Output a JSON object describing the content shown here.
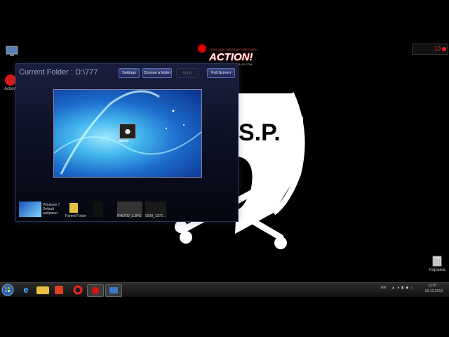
{
  "recorder": {
    "caption": "THIS VIDEO WAS CAPTURED WITH",
    "logo": "ACTION!",
    "url": "WWW.MIRILLIS.COM",
    "widget_time": "10"
  },
  "desktop": {
    "icons": [
      {
        "label": "Action",
        "icon": "record-icon"
      },
      {
        "label": "Корзина",
        "icon": "recycle-bin-icon"
      }
    ]
  },
  "window": {
    "current_folder": "Current Folder : D:\\777",
    "buttons": {
      "settings": "Settings",
      "choose_folder": "Choose a folder",
      "apply": "Apply",
      "full_screen": "Full Screen"
    },
    "preview": {
      "caption": "aaaaa"
    },
    "thumbnails": [
      {
        "label": "Windows 7 Default wallpaper"
      },
      {
        "label": "Parent Folder"
      },
      {
        "label": ""
      },
      {
        "label": "PHOTO_1.JPG"
      },
      {
        "label": "0008_1372..."
      }
    ]
  },
  "emblem": {
    "text": "S.P."
  },
  "taskbar": {
    "apps": [
      "start-orb-icon",
      "ie-icon",
      "explorer-icon",
      "media-player-icon",
      "opera-icon",
      "action-recorder-icon",
      "slideshow-app-icon"
    ],
    "language": "EN",
    "time": "12:07",
    "date": "02.12.2013"
  }
}
